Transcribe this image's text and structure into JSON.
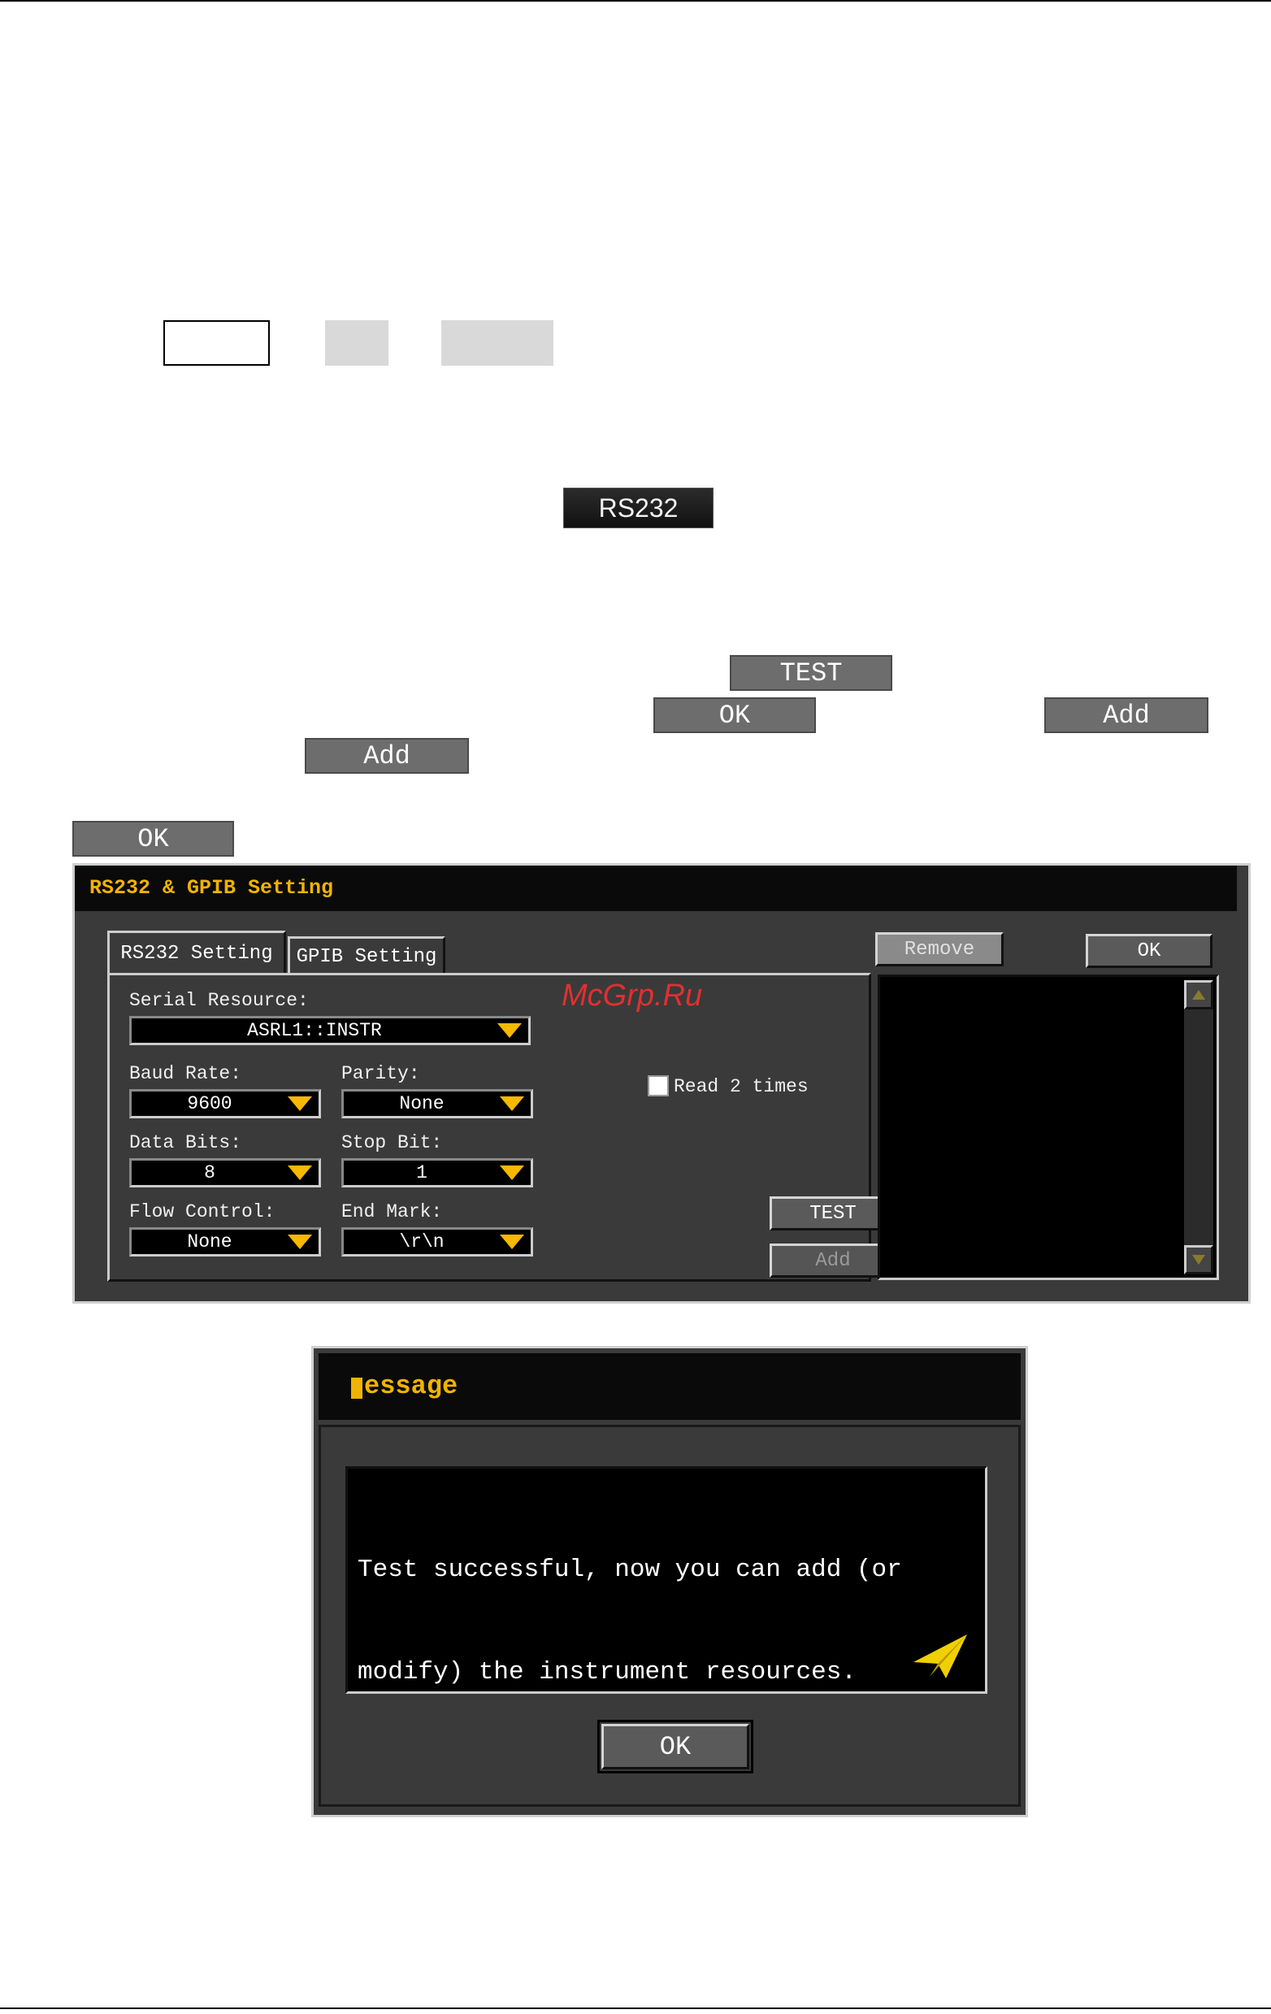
{
  "doc_chips": {
    "rs232": "RS232",
    "test": "TEST",
    "ok_1": "OK",
    "add_1": "Add",
    "add_2": "Add",
    "ok_2": "OK"
  },
  "settings_dialog": {
    "title": "RS232 & GPIB Setting",
    "tabs": [
      "RS232 Setting",
      "GPIB Setting"
    ],
    "serial_resource_label": "Serial Resource:",
    "serial_resource_value": "ASRL1::INSTR",
    "baud_rate_label": "Baud Rate:",
    "baud_rate_value": "9600",
    "parity_label": "Parity:",
    "parity_value": "None",
    "data_bits_label": "Data Bits:",
    "data_bits_value": "8",
    "stop_bit_label": "Stop Bit:",
    "stop_bit_value": "1",
    "flow_control_label": "Flow Control:",
    "flow_control_value": "None",
    "end_mark_label": "End Mark:",
    "end_mark_value": "\\r\\n",
    "read_twice_label": "Read 2 times",
    "test_button": "TEST",
    "add_button": "Add",
    "remove_button": "Remove",
    "ok_button": "OK",
    "watermark": "McGrp.Ru"
  },
  "message_dialog": {
    "title": "essage",
    "text_line1": "Test successful, now you can add (or",
    "text_line2": "modify) the instrument resources.",
    "ok_button": "OK"
  },
  "colors": {
    "title_text": "#f0b400",
    "panel_bg": "#3a3a3a",
    "arrow": "#f7b800",
    "watermark": "#e03030"
  }
}
